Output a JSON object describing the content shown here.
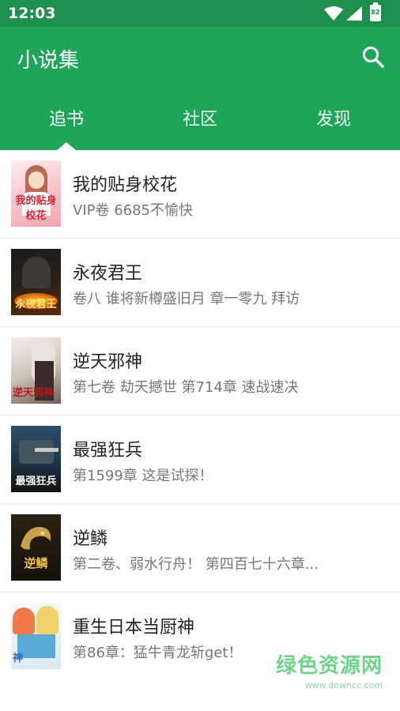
{
  "status_bar": {
    "time": "12:03",
    "battery": "82"
  },
  "app_bar": {
    "title": "小说集"
  },
  "tabs": [
    {
      "label": "追书",
      "active": true
    },
    {
      "label": "社区",
      "active": false
    },
    {
      "label": "发现",
      "active": false
    }
  ],
  "books": [
    {
      "title": "我的贴身校花",
      "latest": "VIP卷 6685不愉快",
      "cover_text": "我的贴身校花"
    },
    {
      "title": "永夜君王",
      "latest": "卷八 谁将新樽盛旧月 章一零九 拜访",
      "cover_text": "永夜君王"
    },
    {
      "title": "逆天邪神",
      "latest": "第七卷 劫天撼世 第714章 速战速决",
      "cover_text": "逆天邪神"
    },
    {
      "title": "最强狂兵",
      "latest": "第1599章 这是试探！",
      "cover_text": "最强狂兵"
    },
    {
      "title": "逆鳞",
      "latest": "第二卷、弱水行舟！ 第四百七十六章...",
      "cover_text": "逆鳞"
    },
    {
      "title": "重生日本当厨神",
      "latest": "第86章：猛牛青龙斩get！",
      "cover_text": "神"
    }
  ],
  "watermark": {
    "name": "绿色资源网",
    "url": "www.downcc.com"
  },
  "colors": {
    "primary": "#1fa55a",
    "status_bar": "#1e8f4d"
  }
}
